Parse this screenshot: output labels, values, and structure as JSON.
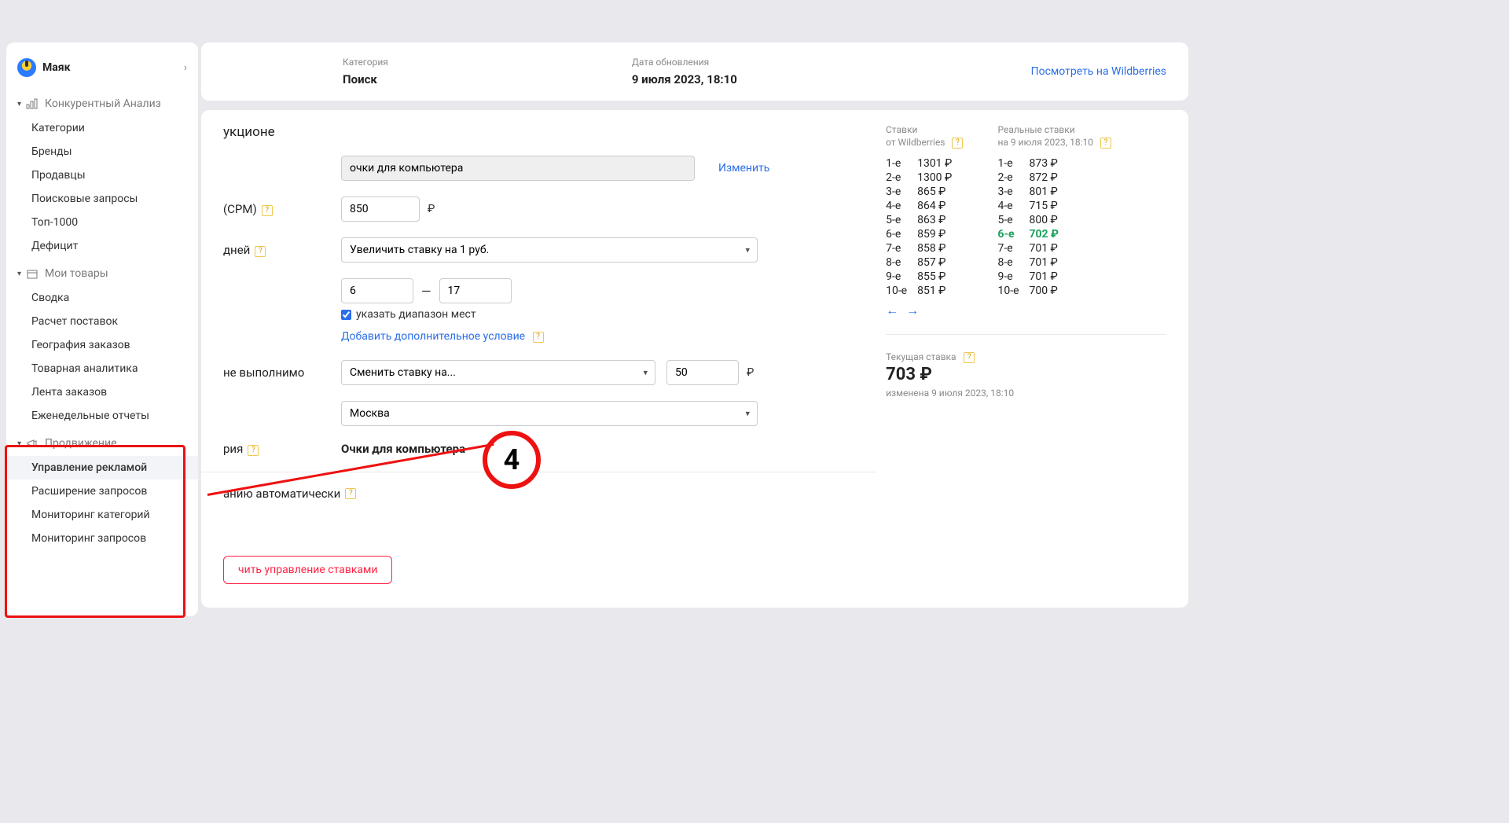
{
  "brand": "Маяк",
  "sidebar": {
    "group1": {
      "title": "Конкурентный Анализ",
      "items": [
        "Категории",
        "Бренды",
        "Продавцы",
        "Поисковые запросы",
        "Топ-1000",
        "Дефицит"
      ]
    },
    "group2": {
      "title": "Мои товары",
      "items": [
        "Сводка",
        "Расчет поставок",
        "География заказов",
        "Товарная аналитика",
        "Лента заказов",
        "Еженедельные отчеты"
      ]
    },
    "group3": {
      "title": "Продвижение",
      "items": [
        "Управление рекламой",
        "Расширение запросов",
        "Мониторинг категорий",
        "Мониторинг запросов"
      ]
    }
  },
  "header": {
    "category_label": "Категория",
    "category_value": "Поиск",
    "updated_label": "Дата обновления",
    "updated_value": "9 июля 2023, 18:10",
    "link": "Посмотреть на Wildberries"
  },
  "form": {
    "auction_title_fragment": "укционе",
    "query_value": "очки для компьютера",
    "change_link": "Изменить",
    "cpm_label_fragment": "(CPM)",
    "cpm_value": "850",
    "currency": "₽",
    "strategy_label_fragment": "дней",
    "strategy_select": "Увеличить ставку на 1 руб.",
    "range_from": "6",
    "range_to": "17",
    "range_checkbox_label": "указать диапазон мест",
    "add_condition_link": "Добавить дополнительное условие",
    "fallback_label_fragment": "не выполнимо",
    "fallback_select": "Сменить ставку на...",
    "fallback_value": "50",
    "city_select": "Москва",
    "goal_label_fragment": "рия",
    "goal_text": "Очки для компьютера",
    "auto_label_fragment": "анию автоматически",
    "button_fragment": "чить управление ставками"
  },
  "rates": {
    "wb_title": "Ставки",
    "wb_sub": "от Wildberries",
    "real_title": "Реальные ставки",
    "real_sub": "на 9 июля 2023, 18:10",
    "wb": [
      {
        "pos": "1-е",
        "val": "1301 ₽"
      },
      {
        "pos": "2-е",
        "val": "1300 ₽"
      },
      {
        "pos": "3-е",
        "val": "865 ₽"
      },
      {
        "pos": "4-е",
        "val": "864 ₽"
      },
      {
        "pos": "5-е",
        "val": "863 ₽"
      },
      {
        "pos": "6-е",
        "val": "859 ₽"
      },
      {
        "pos": "7-е",
        "val": "858 ₽"
      },
      {
        "pos": "8-е",
        "val": "857 ₽"
      },
      {
        "pos": "9-е",
        "val": "855 ₽"
      },
      {
        "pos": "10-е",
        "val": "851 ₽"
      }
    ],
    "real": [
      {
        "pos": "1-е",
        "val": "873 ₽"
      },
      {
        "pos": "2-е",
        "val": "872 ₽"
      },
      {
        "pos": "3-е",
        "val": "801 ₽"
      },
      {
        "pos": "4-е",
        "val": "715 ₽"
      },
      {
        "pos": "5-е",
        "val": "800 ₽"
      },
      {
        "pos": "6-е",
        "val": "702 ₽",
        "hl": true
      },
      {
        "pos": "7-е",
        "val": "701 ₽"
      },
      {
        "pos": "8-е",
        "val": "701 ₽"
      },
      {
        "pos": "9-е",
        "val": "701 ₽"
      },
      {
        "pos": "10-е",
        "val": "700 ₽"
      }
    ],
    "nav_prev": "←",
    "nav_next": "→"
  },
  "current": {
    "label": "Текущая ставка",
    "value": "703 ₽",
    "note": "изменена 9 июля 2023, 18:10"
  },
  "annotation": {
    "number": "4"
  }
}
